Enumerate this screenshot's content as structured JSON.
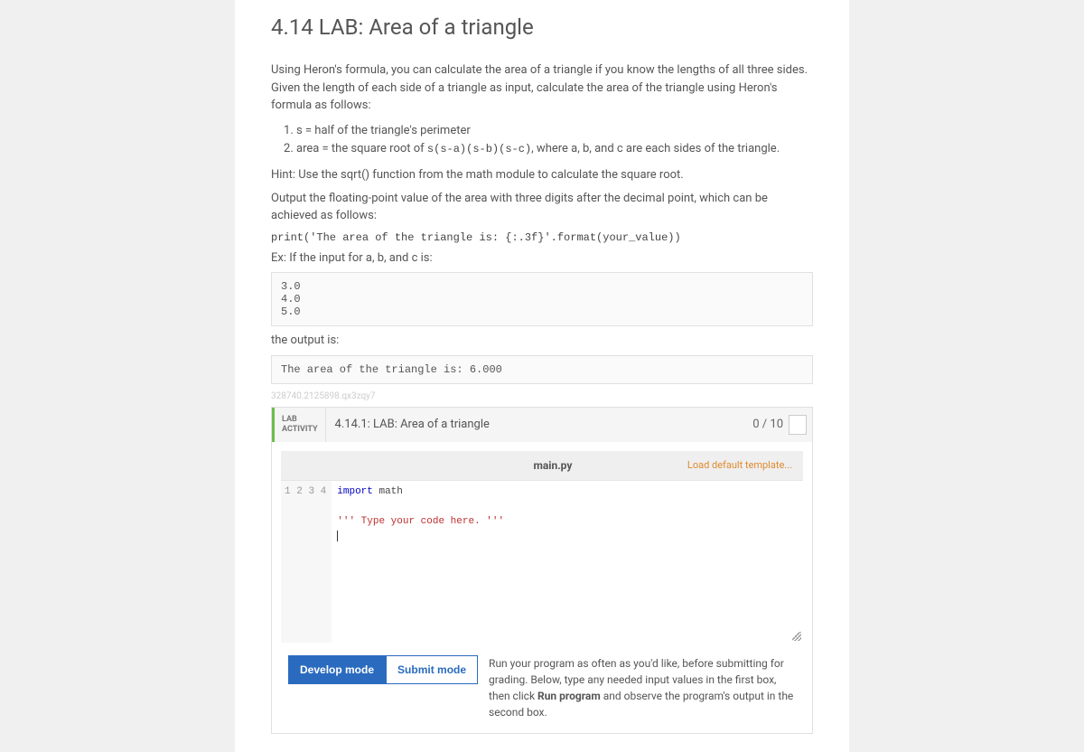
{
  "header": {
    "title": "4.14 LAB: Area of a triangle"
  },
  "intro": "Using Heron's formula, you can calculate the area of a triangle if you know the lengths of all three sides. Given the length of each side of a triangle as input, calculate the area of the triangle using Heron's formula as follows:",
  "steps": {
    "s1": "s = half of the triangle's perimeter",
    "s2_prefix": "area = the square root of ",
    "s2_code": "s(s-a)(s-b)(s-c)",
    "s2_suffix": ", where a, b, and c are each sides of the triangle."
  },
  "hint": "Hint: Use the sqrt() function from the math module to calculate the square root.",
  "output_spec": "Output the floating-point value of the area with three digits after the decimal point, which can be achieved as follows:",
  "print_code": "print('The area of the triangle is: {:.3f}'.format(your_value))",
  "ex_label": "Ex: If the input for a, b, and c is:",
  "ex_input": "3.0\n4.0\n5.0",
  "ex_out_label": "the output is:",
  "ex_output": "The area of the triangle is: 6.000",
  "tinyid": "328740.2125898.qx3zqy7",
  "lab": {
    "tag_line1": "LAB",
    "tag_line2": "ACTIVITY",
    "title": "4.14.1: LAB: Area of a triangle",
    "score": "0 / 10",
    "file": "main.py",
    "load_template": "Load default template...",
    "code": {
      "l1_a": "import",
      "l1_b": " math",
      "l3": "''' Type your code here. '''"
    },
    "gutter": {
      "n1": "1",
      "n2": "2",
      "n3": "3",
      "n4": "4"
    },
    "develop": "Develop mode",
    "submit": "Submit mode",
    "help_a": "Run your program as often as you'd like, before submitting for grading. Below, type any needed input values in the first box, then click ",
    "help_b": "Run program",
    "help_c": " and observe the program's output in the second box."
  }
}
